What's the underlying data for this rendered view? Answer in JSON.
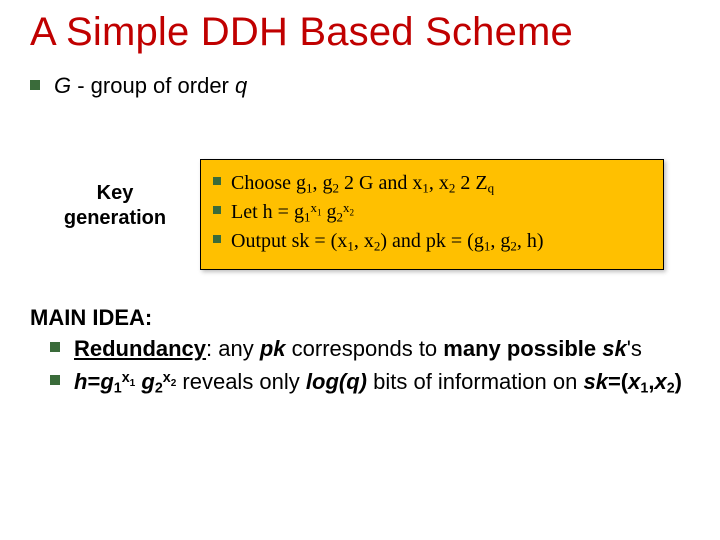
{
  "title": "A Simple DDH Based Scheme",
  "intro": {
    "G": "G",
    "mid": " - group of order ",
    "q": "q"
  },
  "keygen": {
    "label_l1": "Key",
    "label_l2": "generation",
    "items": {
      "choose": {
        "p1": "Choose ",
        "g1": "g",
        "g1s": "1",
        "c1": ", ",
        "g2": "g",
        "g2s": "2",
        "in1a": " 2 ",
        "G": "G",
        "and": " and ",
        "x1": "x",
        "x1s": "1",
        "c2": ", ",
        "x2": "x",
        "x2s": "2",
        "in2a": " 2 ",
        "Z": "Z",
        "Zs": "q"
      },
      "let": {
        "p1": "Let ",
        "h": "h",
        "eq": " = ",
        "g1": "g",
        "g1s": "1",
        "e1": "x",
        "e1s": "1",
        "sp": " ",
        "g2": "g",
        "g2s": "2",
        "e2": "x",
        "e2s": "2"
      },
      "out": {
        "p1": "Output ",
        "sk": "sk",
        "eq1": " = (",
        "x1": "x",
        "x1s": "1",
        "c1": ", ",
        "x2": "x",
        "x2s": "2",
        "cl1": ") and ",
        "pk": "pk",
        "eq2": " = (",
        "g1": "g",
        "g1s": "1",
        "c2": ", ",
        "g2": "g",
        "g2s": "2",
        "c3": ", ",
        "h": "h",
        "cl2": ")"
      }
    }
  },
  "main": {
    "head": "MAIN IDEA:",
    "b1": {
      "red": "Redundancy",
      "mid1": ": any ",
      "pk": "pk",
      "mid2": " corresponds to ",
      "many": "many possible ",
      "sk": "sk",
      "tail": "'s"
    },
    "b2": {
      "h": "h",
      "eq": "=",
      "g1": "g",
      "g1s": "1",
      "e1": "x",
      "e1s": "1",
      "sp": " ",
      "g2": "g",
      "g2s": "2",
      "e2": "x",
      "e2s": "2",
      "mid1": " reveals only ",
      "log": "log(q)",
      "mid2": " bits of information on ",
      "sk": "sk",
      "eq2": "=(",
      "x1": "x",
      "x1s": "1",
      "c1": ",",
      "x2": "x",
      "x2s": "2",
      "cl": ")"
    }
  }
}
